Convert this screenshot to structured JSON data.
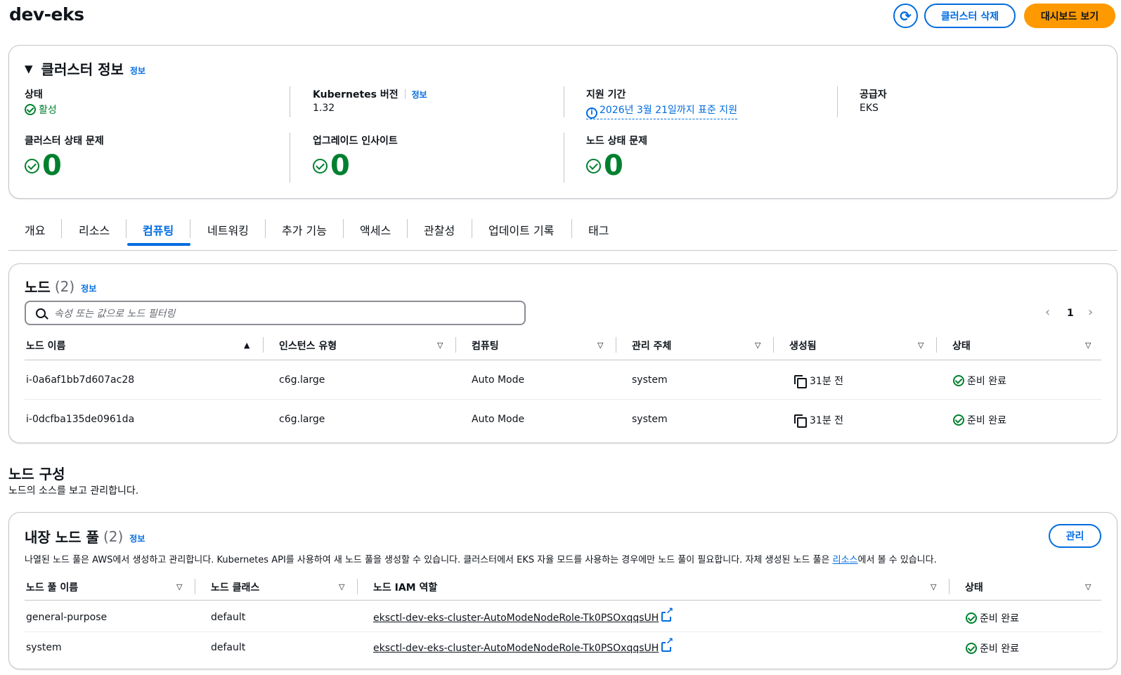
{
  "page_title": "dev-eks",
  "header": {
    "refresh_label": "⟳",
    "delete_label": "클러스터 삭제",
    "dashboard_label": "대시보드 보기"
  },
  "cluster_info": {
    "heading": "클러스터 정보",
    "info_link": "정보",
    "status_label": "상태",
    "status_value": "활성",
    "k8s_label": "Kubernetes 버전",
    "k8s_info": "정보",
    "k8s_value": "1.32",
    "support_label": "지원 기간",
    "support_value": "2026년 3월 21일까지 표준 지원",
    "provider_label": "공급자",
    "provider_value": "EKS",
    "health_label": "클러스터 상태 문제",
    "health_value": "0",
    "upgrade_label": "업그레이드 인사이트",
    "upgrade_value": "0",
    "node_health_label": "노드 상태 문제",
    "node_health_value": "0"
  },
  "tabs": [
    "개요",
    "리소스",
    "컴퓨팅",
    "네트워킹",
    "추가 기능",
    "액세스",
    "관찰성",
    "업데이트 기록",
    "태그"
  ],
  "active_tab": "컴퓨팅",
  "nodes": {
    "heading": "노드",
    "count": "(2)",
    "info_link": "정보",
    "search_placeholder": "속성 또는 값으로 노드 필터링",
    "page": "1",
    "columns": [
      "노드 이름",
      "인스턴스 유형",
      "컴퓨팅",
      "관리 주체",
      "생성됨",
      "상태"
    ],
    "rows": [
      {
        "name": "i-0a6af1bb7d607ac28",
        "instance": "c6g.large",
        "compute": "Auto Mode",
        "managed": "system",
        "created": "31분 전",
        "status": "준비 완료"
      },
      {
        "name": "i-0dcfba135de0961da",
        "instance": "c6g.large",
        "compute": "Auto Mode",
        "managed": "system",
        "created": "31분 전",
        "status": "준비 완료"
      }
    ]
  },
  "node_config": {
    "heading": "노드 구성",
    "subtitle": "노드의 소스를 보고 관리합니다."
  },
  "builtin_pools": {
    "heading": "내장 노드 풀",
    "count": "(2)",
    "info_link": "정보",
    "manage_label": "관리",
    "description_before": "나열된 노드 풀은 AWS에서 생성하고 관리합니다. Kubernetes API를 사용하여 새 노드 풀을 생성할 수 있습니다. 클러스터에서 EKS 자율 모드를 사용하는 경우에만 노드 풀이 필요합니다. 자체 생성된 노드 풀은 ",
    "description_link": "리소스",
    "description_after": "에서 볼 수 있습니다.",
    "columns": [
      "노드 풀 이름",
      "노드 클래스",
      "노드 IAM 역할",
      "상태"
    ],
    "rows": [
      {
        "name": "general-purpose",
        "class": "default",
        "role": "eksctl-dev-eks-cluster-AutoModeNodeRole-Tk0PSOxqqsUH",
        "status": "준비 완료"
      },
      {
        "name": "system",
        "class": "default",
        "role": "eksctl-dev-eks-cluster-AutoModeNodeRole-Tk0PSOxqqsUH",
        "status": "준비 완료"
      }
    ]
  },
  "colors": {
    "accent": "#006ce0",
    "primary_button": "#ff9900",
    "success": "#00802f"
  }
}
